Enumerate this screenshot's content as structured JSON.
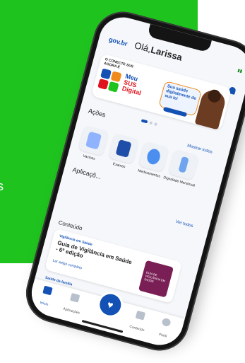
{
  "background": {
    "side_text": "s",
    "accent": "#1ec31e"
  },
  "app": {
    "brand": "gov.br",
    "greeting_prefix": "Olá,",
    "user_name": "Larissa"
  },
  "banner": {
    "kicker": "O CONECTE SUS AGORA É",
    "logo_words": [
      "Meu",
      "SUS",
      "Digital"
    ],
    "bubble_text": "Sua saúde digitalmente de sua lei",
    "brand_blue": "#1351b4",
    "brand_red": "#e0141e",
    "brand_orange": "#f08a1c"
  },
  "actions": {
    "title": "Ações",
    "show_all": "Mostrar todos",
    "items": [
      {
        "label": "Vacinas",
        "icon": "vaccine-icon"
      },
      {
        "label": "Exames",
        "icon": "exam-icon"
      },
      {
        "label": "Medicamentos",
        "icon": "medicine-icon"
      },
      {
        "label": "Dignidade Menstrual",
        "icon": "menstrual-icon"
      }
    ]
  },
  "apps": {
    "title": "Aplicaçõ...",
    "see_all": "Ver todos"
  },
  "content": {
    "title": "Conteúdo",
    "card": {
      "kicker": "Vigilância em Saúde",
      "title": "Guia de Vigilância em Saúde - 6ª edição",
      "link": "Ler artigo completo",
      "cover_text": "GUIA DE VIGILÂNCIA EM SAÚDE"
    },
    "next_kicker": "Saúde da família"
  },
  "tabbar": {
    "items": [
      {
        "label": "Início",
        "icon": "home-icon",
        "active": true
      },
      {
        "label": "Aplicações",
        "icon": "apps-icon",
        "active": false
      },
      {
        "label": "Conteúdo",
        "icon": "content-icon",
        "active": false
      },
      {
        "label": "Perfil",
        "icon": "profile-icon",
        "active": false
      }
    ],
    "center_icon": "heart-icon"
  }
}
